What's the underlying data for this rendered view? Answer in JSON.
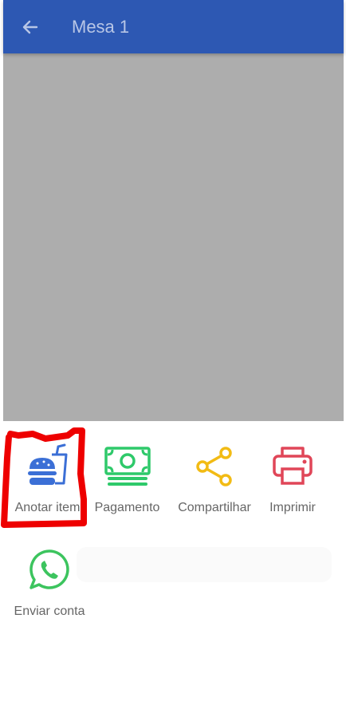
{
  "appbar": {
    "title": "Mesa 1",
    "color": "#2d58b3"
  },
  "backdrop_color": "#adadad",
  "actions": [
    {
      "label": "Anotar item",
      "icon": "burger-soda-icon",
      "color": "#3b6fd6"
    },
    {
      "label": "Pagamento",
      "icon": "cash-icon",
      "color": "#2ec96a"
    },
    {
      "label": "Compartilhar",
      "icon": "share-icon",
      "color": "#f2bb14"
    },
    {
      "label": "Imprimir",
      "icon": "printer-icon",
      "color": "#e04658"
    },
    {
      "label": "Enviar conta",
      "icon": "whatsapp-icon",
      "color": "#3cc45e"
    }
  ],
  "highlight_color": "#ee0000"
}
